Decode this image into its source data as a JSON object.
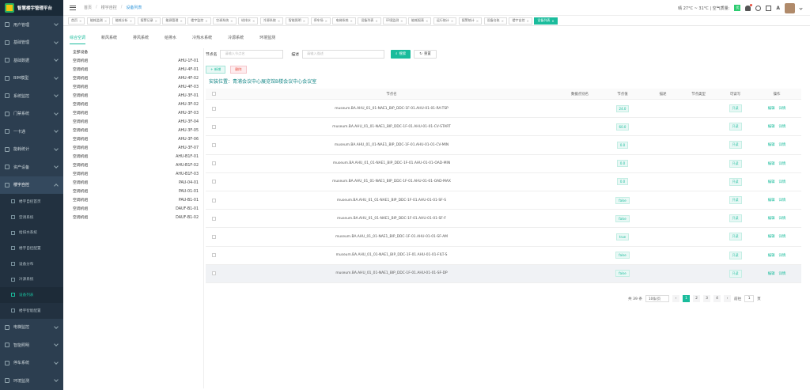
{
  "app": {
    "title": "智慧楼宇管理平台"
  },
  "sidebar": {
    "items": [
      {
        "label": "用户管理",
        "icon": "user-icon"
      },
      {
        "label": "基础管理",
        "icon": "settings-icon"
      },
      {
        "label": "基础数据",
        "icon": "database-icon"
      },
      {
        "label": "BIM模型",
        "icon": "cube-icon"
      },
      {
        "label": "系统监控",
        "icon": "monitor-icon"
      },
      {
        "label": "门禁系统",
        "icon": "door-icon"
      },
      {
        "label": "一卡通",
        "icon": "card-icon"
      },
      {
        "label": "能耗统计",
        "icon": "chart-icon"
      },
      {
        "label": "资产设备",
        "icon": "asset-icon"
      },
      {
        "label": "楼宇自控",
        "icon": "building-icon"
      }
    ],
    "submenu": [
      {
        "label": "楼宇自控首页",
        "icon": "home-icon"
      },
      {
        "label": "空调系统",
        "icon": "ac-icon"
      },
      {
        "label": "给排水系统",
        "icon": "water-icon"
      },
      {
        "label": "楼宇自控配置",
        "icon": "config-icon"
      },
      {
        "label": "设备分布",
        "icon": "distribution-icon"
      },
      {
        "label": "冷源系统",
        "icon": "cold-icon"
      },
      {
        "label": "设备列表",
        "icon": "list-icon"
      },
      {
        "label": "楼宇智能配置",
        "icon": "gear-icon"
      }
    ],
    "bottom_items": [
      {
        "label": "电梯监控",
        "icon": "elevator-icon"
      },
      {
        "label": "智能照明",
        "icon": "light-icon"
      },
      {
        "label": "停车系统",
        "icon": "parking-icon"
      },
      {
        "label": "环境监测",
        "icon": "env-icon"
      }
    ]
  },
  "header": {
    "breadcrumb": [
      "首页",
      "楼宇自控",
      "设备列表"
    ],
    "weather": "晴 27°C ~ 31°C | 空气质量:",
    "aq": "优",
    "font_icon": "A"
  },
  "tags": [
    {
      "label": "首页"
    },
    {
      "label": "能耗监测"
    },
    {
      "label": "能耗分析"
    },
    {
      "label": "报警记录"
    },
    {
      "label": "能源管理"
    },
    {
      "label": "楼宇监控"
    },
    {
      "label": "空调系统"
    },
    {
      "label": "给排水"
    },
    {
      "label": "冷源系统"
    },
    {
      "label": "智能照明"
    },
    {
      "label": "停车场"
    },
    {
      "label": "电梯系统"
    },
    {
      "label": "设备列表"
    },
    {
      "label": "环境监测"
    },
    {
      "label": "能耗报表"
    },
    {
      "label": "运行统计"
    },
    {
      "label": "报警统计"
    },
    {
      "label": "设备台账"
    },
    {
      "label": "楼宇自控"
    },
    {
      "label": "设备列表",
      "active": true
    }
  ],
  "subtabs": [
    "综合空调",
    "新风系统",
    "排风系统",
    "给排水",
    "冷热水系统",
    "冷源系统",
    "环境监测"
  ],
  "tree": {
    "root": "全部设备",
    "rows": [
      {
        "name": "空调机组",
        "code": "AHU-1F-01"
      },
      {
        "name": "空调机组",
        "code": "AHU-4F-01"
      },
      {
        "name": "空调机组",
        "code": "AHU-4F-02"
      },
      {
        "name": "空调机组",
        "code": "AHU-4F-03"
      },
      {
        "name": "空调机组",
        "code": "AHU-3F-01"
      },
      {
        "name": "空调机组",
        "code": "AHU-3F-02"
      },
      {
        "name": "空调机组",
        "code": "AHU-3F-03"
      },
      {
        "name": "空调机组",
        "code": "AHU-3F-04"
      },
      {
        "name": "空调机组",
        "code": "AHU-3F-05"
      },
      {
        "name": "空调机组",
        "code": "AHU-3F-06"
      },
      {
        "name": "空调机组",
        "code": "AHU-3F-07"
      },
      {
        "name": "空调机组",
        "code": "AHU-B1F-01"
      },
      {
        "name": "空调机组",
        "code": "AHU-B1F-02"
      },
      {
        "name": "空调机组",
        "code": "AHU-B1F-03"
      },
      {
        "name": "空调机组",
        "code": "PAU-04-01"
      },
      {
        "name": "空调机组",
        "code": "PAU-01-01"
      },
      {
        "name": "空调机组",
        "code": "PAU-B1-01"
      },
      {
        "name": "空调机组",
        "code": "DAUF-B1-01"
      },
      {
        "name": "空调机组",
        "code": "DAUF-B1-02"
      }
    ]
  },
  "filter": {
    "label1": "节点名",
    "ph1": "请输入节点名",
    "label2": "描述",
    "ph2": "请输入描述",
    "search": "搜索",
    "reset": "重置"
  },
  "actions": {
    "add": "+ 新增",
    "delete": "删除"
  },
  "install_position": "安装位置：青浦会议中心展览馆B楼会议中心会议室",
  "table": {
    "headers": {
      "name": "节点名",
      "alias": "数据点别名",
      "value": "节点值",
      "desc": "描述",
      "type": "节点类型",
      "writable": "可读写",
      "op": "操作"
    },
    "rows": [
      {
        "name": "museum.BA.AHU_01_01-NAE1_BIP_DDC-1F-01.AHU-01-01-RA-TSP",
        "value": "24.0",
        "writable": "只读"
      },
      {
        "name": "museum.BA.AHU_01_01-NAE1_BIP_DDC-1F-01.AHU-01-01-CV-START",
        "value": "60.0",
        "writable": "只读"
      },
      {
        "name": "museum.BA.AHU_01_01-NAE1_BIP_DDC-1F-01.AHU-01-01-CV-MIN",
        "value": "0.0",
        "writable": "只读"
      },
      {
        "name": "museum.BA.AHU_01_01-NAE1_BIP_DDC-1F-01.AHU-01-01-OAD-MIN",
        "value": "0.0",
        "writable": "只读"
      },
      {
        "name": "museum.BA.AHU_01_01-NAE1_BIP_DDC-1F-01.AHU-01-01-OAD-MAX",
        "value": "0.0",
        "writable": "只读"
      },
      {
        "name": "museum.BA.AHU_01_01-NAE1_BIP_DDC-1F-01.AHU-01-01-SF-S",
        "value": "false",
        "writable": "只读"
      },
      {
        "name": "museum.BA.AHU_01_01-NAE1_BIP_DDC-1F-01.AHU-01-01-SF-F",
        "value": "false",
        "writable": "只读"
      },
      {
        "name": "museum.BA.AHU_01_01-NAE1_BIP_DDC-1F-01.AHU-01-01-SF-AM",
        "value": "true",
        "writable": "只读"
      },
      {
        "name": "museum.BA.AHU_01_01-NAE1_BIP_DDC-1F-01.AHU-01-01-FILT-S",
        "value": "false",
        "writable": "只读"
      },
      {
        "name": "museum.BA.AHU_01_01-NAE1_BIP_DDC-1F-01.AHU-01-01-SF-DP",
        "value": "false",
        "writable": "只读"
      }
    ],
    "op_edit": "编辑",
    "op_detail": "详情"
  },
  "pager": {
    "total": "共 39 条",
    "size": "10条/页",
    "prev": "‹",
    "pages": [
      "1",
      "2",
      "3",
      "4"
    ],
    "next": "›",
    "goto": "前往",
    "page_input": "1",
    "page_unit": "页"
  },
  "colors": {
    "accent": "#1abc9c",
    "sidebar": "#2c3e50"
  }
}
